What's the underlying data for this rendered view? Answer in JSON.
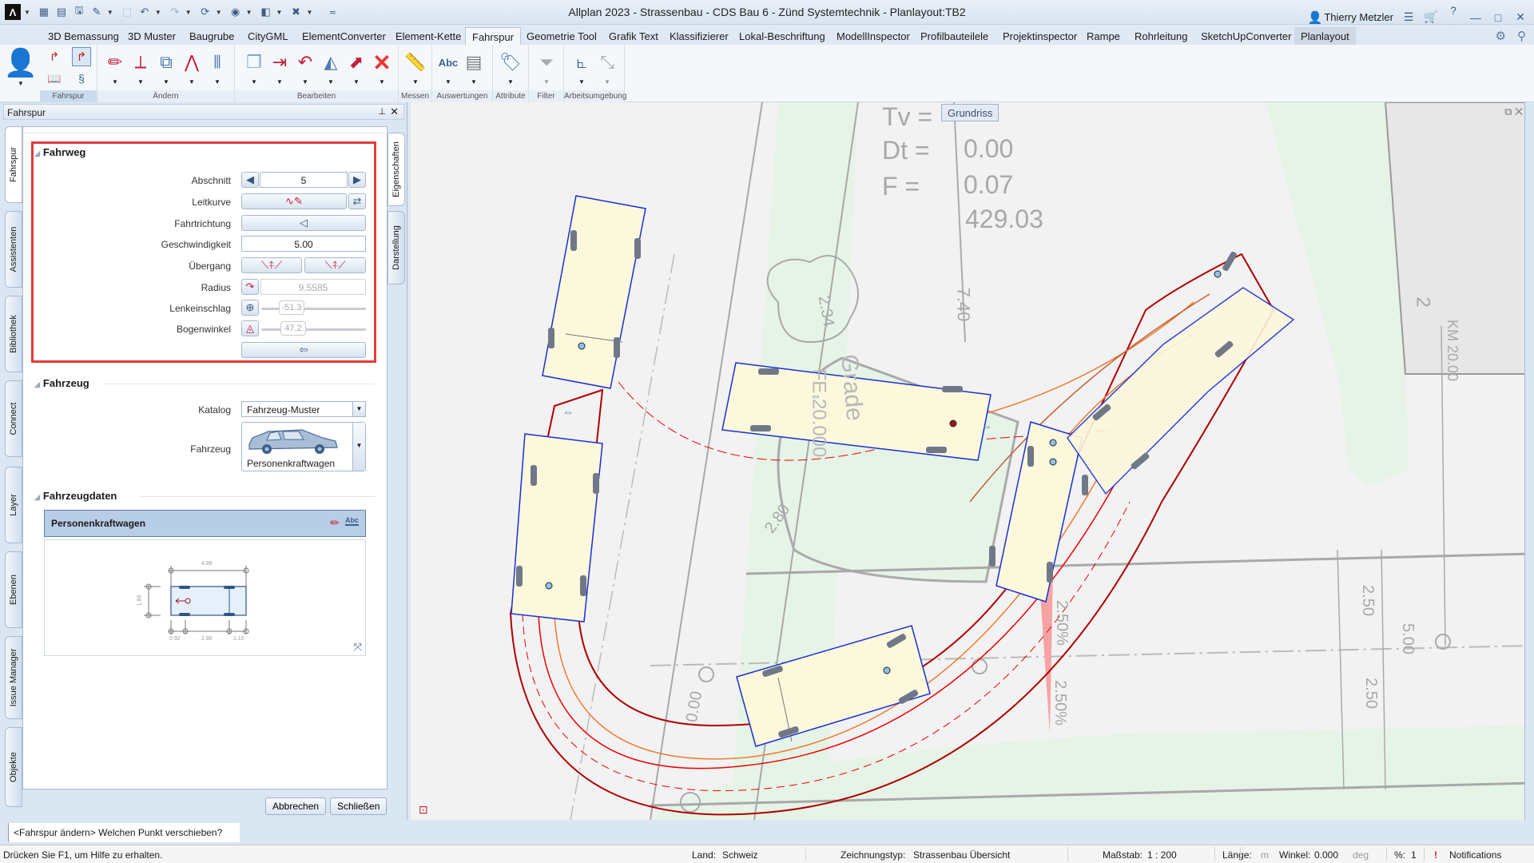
{
  "window": {
    "title": "Allplan 2023 - Strassenbau - CDS Bau 6 - Zünd Systemtechnik - Planlayout:TB2",
    "user": "Thierry Metzler",
    "logo": "Λ"
  },
  "quick_access": [
    "new-project-icon",
    "layout-icon",
    "save-icon",
    "edit-icon",
    "select-icon",
    "undo-icon",
    "redo-icon",
    "refresh-icon",
    "view-icon",
    "window-icon",
    "tools-icon",
    "customize-icon"
  ],
  "tabs": [
    {
      "label": "3D Bemassung"
    },
    {
      "label": "3D Muster"
    },
    {
      "label": "Baugrube"
    },
    {
      "label": "CityGML"
    },
    {
      "label": "ElementConverter"
    },
    {
      "label": "Element-Kette"
    },
    {
      "label": "Fahrspur",
      "active": true
    },
    {
      "label": "Geometrie Tool"
    },
    {
      "label": "Grafik Text"
    },
    {
      "label": "Klassifizierer"
    },
    {
      "label": "Lokal-Beschriftung"
    },
    {
      "label": "ModellInspector"
    },
    {
      "label": "Profilbauteilele"
    },
    {
      "label": "Projektinspector"
    },
    {
      "label": "Rampe"
    },
    {
      "label": "Rohrleitung"
    },
    {
      "label": "SketchUpConverter"
    },
    {
      "label": "Planlayout"
    }
  ],
  "ribbon_groups": [
    {
      "label": "Fahrspur"
    },
    {
      "label": "Ändern"
    },
    {
      "label": "Bearbeiten"
    },
    {
      "label": "Messen"
    },
    {
      "label": "Auswertungen"
    },
    {
      "label": "Attribute"
    },
    {
      "label": "Filter"
    },
    {
      "label": "Arbeitsumgebung"
    }
  ],
  "ribbon_auswertungen_abc": "Abc",
  "panel": {
    "title": "Fahrspur",
    "left_tabs": [
      "Fahrspur",
      "Assistenten",
      "Bibliothek",
      "Connect",
      "Layer",
      "Ebenen",
      "Issue Manager",
      "Objekte"
    ],
    "right_tabs": [
      "Eigenschaften",
      "Darstellung"
    ],
    "fahrweg": {
      "title": "Fahrweg",
      "abschnitt_label": "Abschnitt",
      "abschnitt_value": "5",
      "leitkurve_label": "Leitkurve",
      "fahrtrichtung_label": "Fahrtrichtung",
      "geschwindigkeit_label": "Geschwindigkeit",
      "geschwindigkeit_value": "5.00",
      "uebergang_label": "Übergang",
      "radius_label": "Radius",
      "radius_value": "9.5585",
      "lenkeinschlag_label": "Lenkeinschlag",
      "lenkeinschlag_value": "-51.3",
      "bogenwinkel_label": "Bogenwinkel",
      "bogenwinkel_value": "47.2"
    },
    "fahrzeug": {
      "title": "Fahrzeug",
      "katalog_label": "Katalog",
      "katalog_value": "Fahrzeug-Muster",
      "fahrzeug_label": "Fahrzeug",
      "fahrzeug_value": "Personenkraftwagen"
    },
    "fahrzeugdaten": {
      "title": "Fahrzeugdaten",
      "vehicle_name": "Personenkraftwagen",
      "length": "4.88",
      "width": "1.89",
      "front_overhang": "0.92",
      "wheelbase": "2.86",
      "rear_overhang": "1.10"
    },
    "buttons": {
      "cancel": "Abbrechen",
      "close": "Schließen"
    }
  },
  "canvas": {
    "view_tag": "Grundriss",
    "annotations": {
      "tv_label": "Tv =",
      "dt_label": "Dt =",
      "dt_value": "0.00",
      "f_label": "F  =",
      "f_value": "0.07",
      "elevation": "429.03",
      "dim_740": "7.40",
      "dim_234": "2.34",
      "grade_label": "Grade",
      "fe_label": "FE 20.000",
      "dim_280": "2.80",
      "slope_1": "2.50%",
      "slope_2": "2.50%",
      "lane_1": "2.50",
      "lane_2": "2.50",
      "total_width": "5.00",
      "station_000": "0.00",
      "km_label": "KM 20.00",
      "km_marker": "2"
    },
    "colors": {
      "envelope": "#b00000",
      "track": "#f07a30",
      "vehicle_outline": "#1a2fd0",
      "vehicle_fill": "#fbf8dc",
      "green_area": "#e6f4e7",
      "slope_fill": "#f7a3a3"
    }
  },
  "command": {
    "prompt": "<Fahrspur ändern> Welchen Punkt verschieben?"
  },
  "status": {
    "help": "Drücken Sie F1, um Hilfe zu erhalten.",
    "land_label": "Land:",
    "land_value": "Schweiz",
    "zeichnungstyp_label": "Zeichnungstyp:",
    "zeichnungstyp_value": "Strassenbau Übersicht",
    "massstab_label": "Maßstab:",
    "massstab_value": "1 : 200",
    "laenge_label": "Länge:",
    "laenge_unit": "m",
    "winkel_label": "Winkel:",
    "winkel_value": "0.000",
    "winkel_unit": "deg",
    "percent_label": "%:",
    "percent_value": "1",
    "notifications": "Notifications"
  }
}
